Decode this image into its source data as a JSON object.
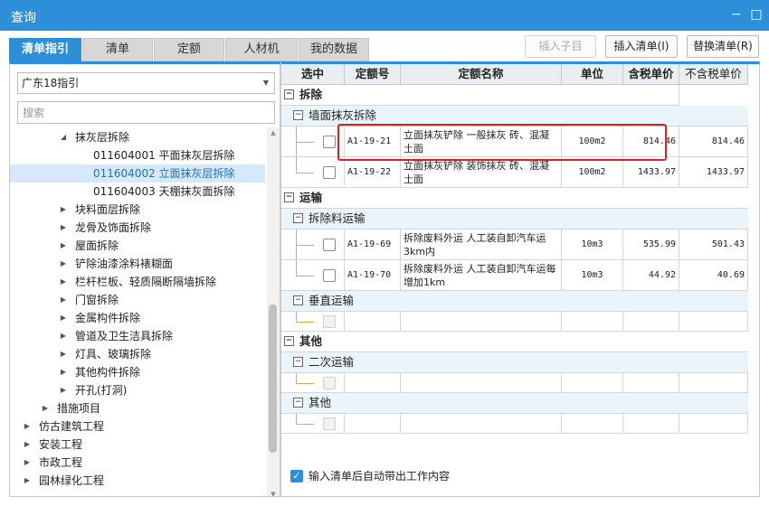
{
  "window": {
    "title": "查询",
    "minimize_icon": "−",
    "maximize_icon": "□"
  },
  "tabs": [
    "清单指引",
    "清单",
    "定额",
    "人材机",
    "我的数据"
  ],
  "buttons": {
    "insert_child": "插入子目",
    "insert_list": "插入清单(I)",
    "replace_list": "替换清单(R)"
  },
  "left": {
    "select_value": "广东18指引",
    "search_placeholder": "搜索",
    "tree": [
      {
        "label": "抹灰层拆除"
      },
      {
        "label": "011604001  平面抹灰层拆除"
      },
      {
        "label": "011604002  立面抹灰层拆除"
      },
      {
        "label": "011604003  天棚抹灰面拆除"
      },
      {
        "label": "块料面层拆除"
      },
      {
        "label": "龙骨及饰面拆除"
      },
      {
        "label": "屋面拆除"
      },
      {
        "label": "铲除油漆涂料裱糊面"
      },
      {
        "label": "栏杆栏板、轻质隔断隔墙拆除"
      },
      {
        "label": "门窗拆除"
      },
      {
        "label": "金属构件拆除"
      },
      {
        "label": "管道及卫生洁具拆除"
      },
      {
        "label": "灯具、玻璃拆除"
      },
      {
        "label": "其他构件拆除"
      },
      {
        "label": "开孔(打洞)"
      },
      {
        "label": "措施项目"
      },
      {
        "label": "仿古建筑工程"
      },
      {
        "label": "安装工程"
      },
      {
        "label": "市政工程"
      },
      {
        "label": "园林绿化工程"
      }
    ]
  },
  "grid": {
    "headers": [
      "选中",
      "定额号",
      "定额名称",
      "单位",
      "含税单价",
      "不含税单价"
    ],
    "groups": {
      "g1": "拆除",
      "g1a": "墙面抹灰拆除",
      "g2": "运输",
      "g2a": "拆除料运输",
      "g2b": "垂直运输",
      "g3": "其他",
      "g3a": "二次运输",
      "g3b": "其他"
    },
    "rows": [
      {
        "code": "A1-19-21",
        "name": "立面抹灰铲除 一般抹灰 砖、混凝土面",
        "unit": "100m2",
        "tax_price": "814.46",
        "notax_price": "814.46"
      },
      {
        "code": "A1-19-22",
        "name": "立面抹灰铲除 装饰抹灰 砖、混凝土面",
        "unit": "100m2",
        "tax_price": "1433.97",
        "notax_price": "1433.97"
      },
      {
        "code": "A1-19-69",
        "name": "拆除废料外运 人工装自卸汽车运3km内",
        "unit": "10m3",
        "tax_price": "535.99",
        "notax_price": "501.43"
      },
      {
        "code": "A1-19-70",
        "name": "拆除废料外运 人工装自卸汽车运每增加1km",
        "unit": "10m3",
        "tax_price": "44.92",
        "notax_price": "40.69"
      }
    ]
  },
  "footer": {
    "checkbox_label": "输入清单后自动带出工作内容",
    "checked": true
  },
  "icons": {
    "expanded": "◢",
    "collapsed": "▶",
    "minus": "−",
    "check": "✓"
  },
  "colors": {
    "accent": "#2d8fd9",
    "highlight": "#e02020",
    "selected_row": "#d6e9fb"
  }
}
